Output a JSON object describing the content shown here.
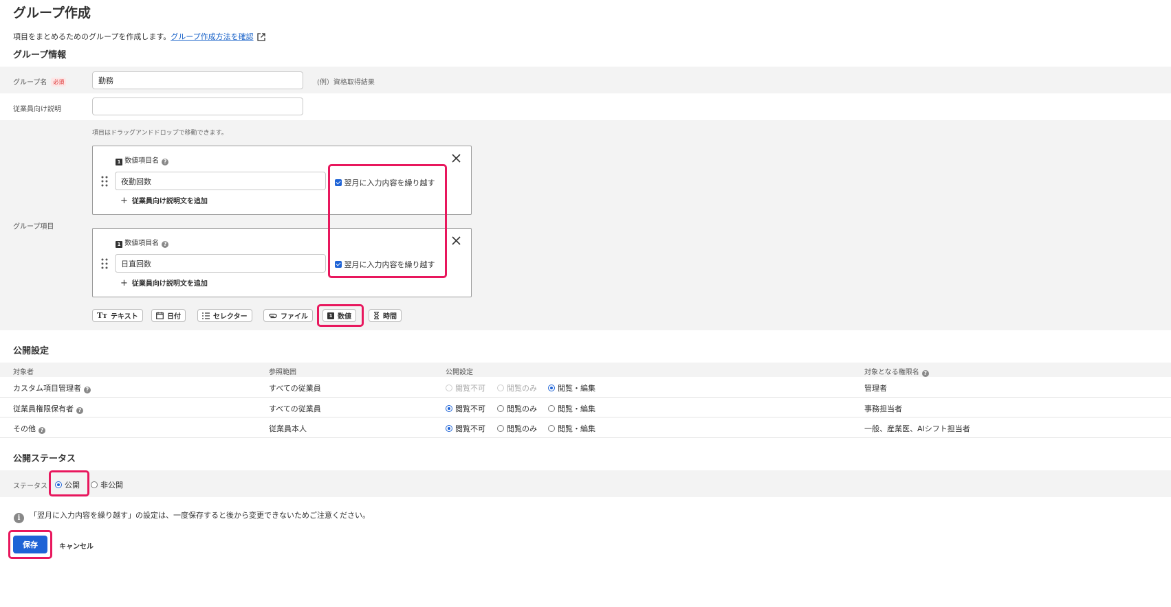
{
  "page": {
    "title": "グループ作成",
    "description": "項目をまとめるためのグループを作成します。",
    "help_link": "グループ作成方法を確認"
  },
  "group_info": {
    "section_title": "グループ情報",
    "name_label": "グループ名",
    "required_badge": "必須",
    "name_value": "勤務",
    "name_example": "(例）資格取得結果",
    "employee_desc_label": "従業員向け説明",
    "employee_desc_value": "",
    "items_label": "グループ項目",
    "drag_hint": "項目はドラッグアンドドロップで移動できます。",
    "items": [
      {
        "type_label": "数値項目名",
        "type_badge": "1",
        "value": "夜勤回数",
        "carry_over_label": "翌月に入力内容を繰り越す",
        "carry_over_checked": true,
        "add_desc": "従業員向け説明文を追加"
      },
      {
        "type_label": "数値項目名",
        "type_badge": "1",
        "value": "日直回数",
        "carry_over_label": "翌月に入力内容を繰り越す",
        "carry_over_checked": true,
        "add_desc": "従業員向け説明文を追加"
      }
    ],
    "type_buttons": [
      {
        "label": "テキスト",
        "icon": "Tт"
      },
      {
        "label": "日付",
        "icon": "calendar-icon"
      },
      {
        "label": "セレクター",
        "icon": "list-icon"
      },
      {
        "label": "ファイル",
        "icon": "paperclip-icon"
      },
      {
        "label": "数値",
        "icon": "number-icon"
      },
      {
        "label": "時間",
        "icon": "hourglass-icon"
      }
    ]
  },
  "publish_settings": {
    "section_title": "公開設定",
    "headers": [
      "対象者",
      "参照範囲",
      "公開設定",
      "対象となる権限名"
    ],
    "options": [
      "閲覧不可",
      "閲覧のみ",
      "閲覧・編集"
    ],
    "rows": [
      {
        "target": "カスタム項目管理者",
        "scope": "すべての従業員",
        "selected": 2,
        "disabled_first_two": true,
        "role": "管理者"
      },
      {
        "target": "従業員権限保有者",
        "scope": "すべての従業員",
        "selected": 0,
        "disabled_first_two": false,
        "role": "事務担当者"
      },
      {
        "target": "その他",
        "scope": "従業員本人",
        "selected": 0,
        "disabled_first_two": false,
        "role": "一般、産業医、AIシフト担当者"
      }
    ]
  },
  "publish_status": {
    "section_title": "公開ステータス",
    "label": "ステータス",
    "options": [
      "公開",
      "非公開"
    ],
    "selected": 0
  },
  "notice": "「翌月に入力内容を繰り越す」の設定は、一度保存すると後から変更できないためご注意ください。",
  "actions": {
    "save": "保存",
    "cancel": "キャンセル"
  },
  "colors": {
    "accent": "#1e63d6",
    "highlight": "#e8175d",
    "band": "#f3f3f3"
  }
}
